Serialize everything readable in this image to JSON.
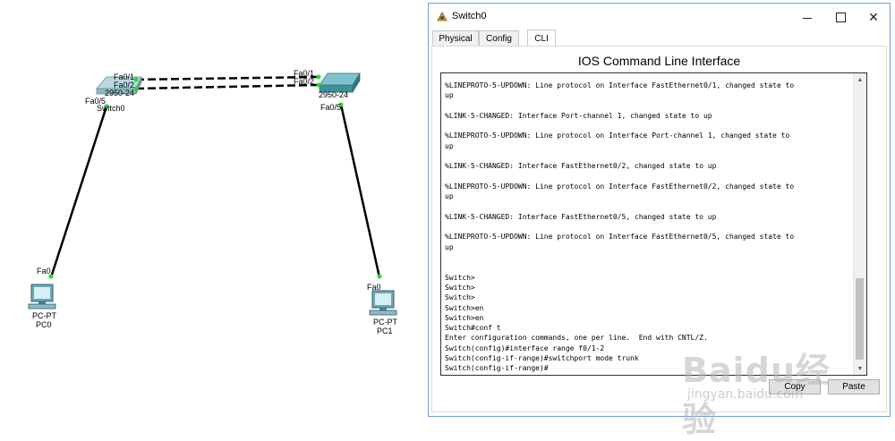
{
  "topology": {
    "switch0": {
      "model": "2950-24",
      "name": "Switch0"
    },
    "switch1": {
      "model": "2950-24"
    },
    "pc0": {
      "model": "PC-PT",
      "name": "PC0"
    },
    "pc1": {
      "model": "PC-PT",
      "name": "PC1"
    },
    "ports": {
      "sw0_fa01": "Fa0/1",
      "sw0_fa02": "Fa0/2",
      "sw0_fa05": "Fa0/5",
      "sw1_fa01": "Fa0/1",
      "sw1_fa02": "Fa0/2",
      "sw1_fa05": "Fa0/5",
      "pc0_fa0": "Fa0",
      "pc1_fa0": "Fa0"
    },
    "colors": {
      "link": "#000000",
      "port_up": "#22dd22",
      "switch": "#4f9fa8"
    }
  },
  "window": {
    "title": "Switch0",
    "tabs": [
      "Physical",
      "Config",
      "CLI"
    ],
    "active_tab": "CLI",
    "heading": "IOS Command Line Interface",
    "terminal_lines": [
      "%LINEPROTO-5-UPDOWN: Line protocol on Interface FastEthernet0/1, changed state to",
      "up",
      "",
      "%LINK-5-CHANGED: Interface Port-channel 1, changed state to up",
      "",
      "%LINEPROTO-5-UPDOWN: Line protocol on Interface Port-channel 1, changed state to",
      "up",
      "",
      "%LINK-5-CHANGED: Interface FastEthernet0/2, changed state to up",
      "",
      "%LINEPROTO-5-UPDOWN: Line protocol on Interface FastEthernet0/2, changed state to",
      "up",
      "",
      "%LINK-5-CHANGED: Interface FastEthernet0/5, changed state to up",
      "",
      "%LINEPROTO-5-UPDOWN: Line protocol on Interface FastEthernet0/5, changed state to",
      "up",
      "",
      "",
      "Switch>",
      "Switch>",
      "Switch>",
      "Switch>en",
      "Switch>en",
      "Switch#conf t",
      "Enter configuration commands, one per line.  End with CNTL/Z.",
      "Switch(config)#interface range f0/1-2",
      "Switch(config-if-range)#switchport mode trunk",
      "Switch(config-if-range)#"
    ],
    "buttons": {
      "copy": "Copy",
      "paste": "Paste"
    }
  },
  "watermark": {
    "brand": "Baidu经验",
    "url": "jingyan.baidu.com"
  }
}
